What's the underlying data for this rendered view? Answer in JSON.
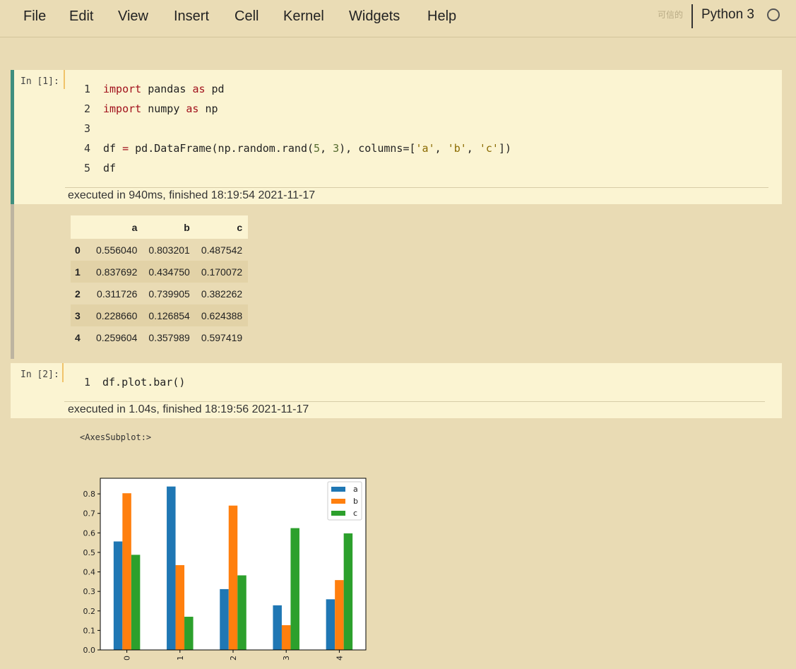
{
  "menu": [
    "File",
    "Edit",
    "View",
    "Insert",
    "Cell",
    "Kernel",
    "Widgets",
    "Help"
  ],
  "trusted_label": "可信的",
  "kernel_name": "Python 3",
  "cell1": {
    "prompt": "In  [1]:",
    "lines": [
      {
        "n": "1",
        "code": "import pandas as pd"
      },
      {
        "n": "2",
        "code": "import numpy as np"
      },
      {
        "n": "3",
        "code": ""
      },
      {
        "n": "4",
        "code": "df = pd.DataFrame(np.random.rand(5, 3), columns=['a', 'b', 'c'])"
      },
      {
        "n": "5",
        "code": "df"
      }
    ],
    "exec_info": "executed in 940ms, finished 18:19:54 2021-11-17"
  },
  "dataframe": {
    "columns": [
      "",
      "a",
      "b",
      "c"
    ],
    "rows": [
      [
        "0",
        "0.556040",
        "0.803201",
        "0.487542"
      ],
      [
        "1",
        "0.837692",
        "0.434750",
        "0.170072"
      ],
      [
        "2",
        "0.311726",
        "0.739905",
        "0.382262"
      ],
      [
        "3",
        "0.228660",
        "0.126854",
        "0.624388"
      ],
      [
        "4",
        "0.259604",
        "0.357989",
        "0.597419"
      ]
    ]
  },
  "cell2": {
    "prompt": "In  [2]:",
    "lines": [
      {
        "n": "1",
        "code": "df.plot.bar()"
      }
    ],
    "exec_info": "executed in 1.04s, finished 18:19:56 2021-11-17"
  },
  "output2_text": "<AxesSubplot:>",
  "chart_data": {
    "type": "bar",
    "categories": [
      "0",
      "1",
      "2",
      "3",
      "4"
    ],
    "series": [
      {
        "name": "a",
        "color": "#1f77b4",
        "values": [
          0.55604,
          0.837692,
          0.311726,
          0.22866,
          0.259604
        ]
      },
      {
        "name": "b",
        "color": "#ff7f0e",
        "values": [
          0.803201,
          0.43475,
          0.739905,
          0.126854,
          0.357989
        ]
      },
      {
        "name": "c",
        "color": "#2ca02c",
        "values": [
          0.487542,
          0.170072,
          0.382262,
          0.624388,
          0.597419
        ]
      }
    ],
    "yticks": [
      "0.0",
      "0.1",
      "0.2",
      "0.3",
      "0.4",
      "0.5",
      "0.6",
      "0.7",
      "0.8"
    ],
    "ylim": [
      0,
      0.88
    ],
    "legend": "top-right",
    "grid": false
  }
}
